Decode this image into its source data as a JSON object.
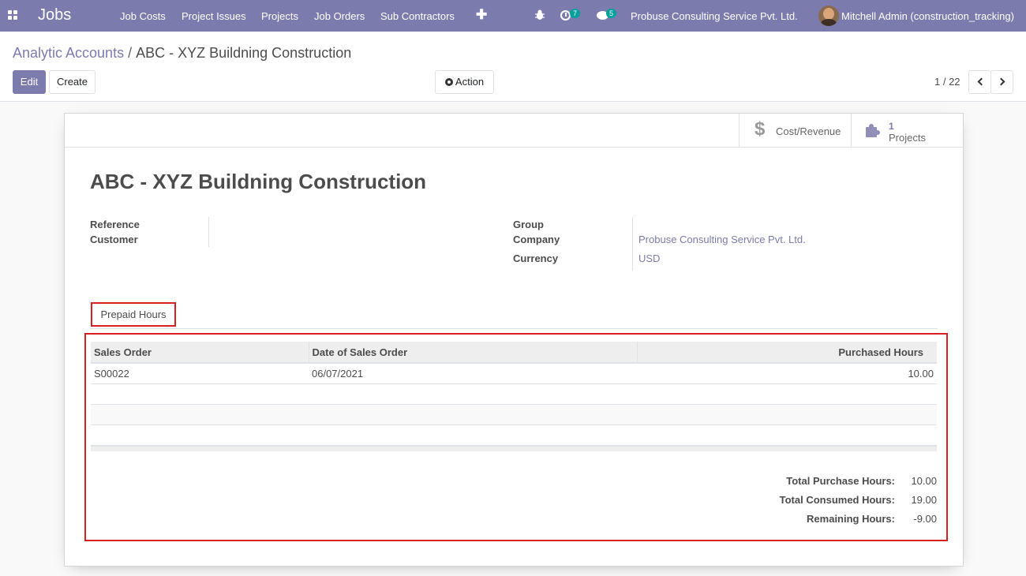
{
  "navbar": {
    "brand": "Jobs",
    "menu": [
      "Job Costs",
      "Project Issues",
      "Projects",
      "Job Orders",
      "Sub Contractors"
    ],
    "activity_count": "7",
    "message_count": "5",
    "company": "Probuse Consulting Service Pvt. Ltd.",
    "user": "Mitchell Admin (construction_tracking)"
  },
  "breadcrumb": {
    "parent": "Analytic Accounts",
    "separator": "/",
    "current": "ABC - XYZ Buildning Construction"
  },
  "buttons": {
    "edit": "Edit",
    "create": "Create",
    "action": "Action"
  },
  "pager": {
    "value": "1 / 22"
  },
  "smart_buttons": {
    "cost_revenue": "Cost/Revenue",
    "projects_count": "1",
    "projects_label": "Projects"
  },
  "record": {
    "title": "ABC - XYZ Buildning Construction",
    "labels": {
      "reference": "Reference",
      "customer": "Customer",
      "group": "Group",
      "company": "Company",
      "currency": "Currency"
    },
    "company": "Probuse Consulting Service Pvt. Ltd.",
    "currency": "USD"
  },
  "tab": {
    "label": "Prepaid Hours"
  },
  "table": {
    "headers": [
      "Sales Order",
      "Date of Sales Order",
      "Purchased Hours"
    ],
    "rows": [
      {
        "sales_order": "S00022",
        "date": "06/07/2021",
        "hours": "10.00"
      }
    ]
  },
  "totals": {
    "purchase_label": "Total Purchase Hours:",
    "purchase_value": "10.00",
    "consumed_label": "Total Consumed Hours:",
    "consumed_value": "19.00",
    "remaining_label": "Remaining Hours:",
    "remaining_value": "-9.00"
  },
  "colors": {
    "brand": "#7c7bad",
    "highlight": "#d62020",
    "badge": "#00a09d"
  }
}
